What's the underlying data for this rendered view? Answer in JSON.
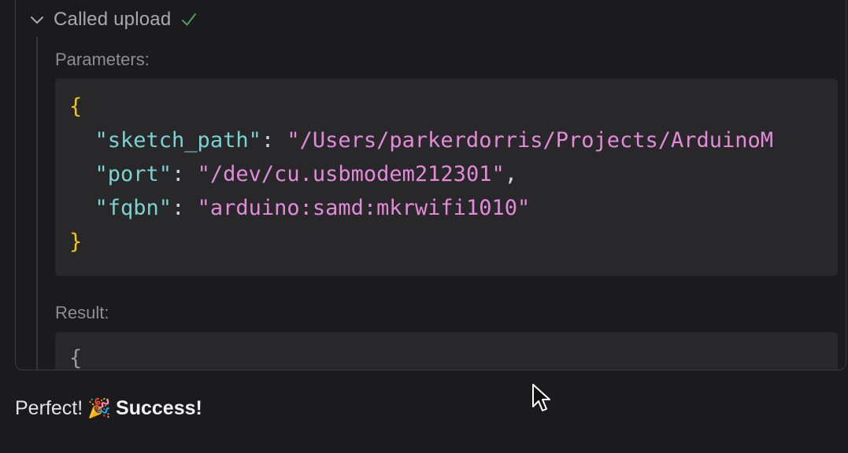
{
  "tool_call": {
    "title": "Called upload",
    "status_icon": "check-icon",
    "parameters_label": "Parameters:",
    "result_label": "Result:",
    "params": {
      "open_brace": "{",
      "close_brace": "}",
      "lines": [
        {
          "key": "\"sketch_path\"",
          "value": "\"/Users/parkerdorris/Projects/ArduinoM",
          "trail": ""
        },
        {
          "key": "\"port\"",
          "value": "\"/dev/cu.usbmodem212301\"",
          "trail": ","
        },
        {
          "key": "\"fqbn\"",
          "value": "\"arduino:samd:mkrwifi1010\"",
          "trail": ""
        }
      ]
    },
    "result_preview": "{"
  },
  "message": {
    "text": "Perfect!",
    "emoji": "🎉",
    "strong": "Success!"
  },
  "colors": {
    "background": "#1b1b1d",
    "code_bg": "#28282b",
    "brace": "#f5c518",
    "key": "#7ad3d1",
    "string": "#e38ad9",
    "check": "#4caf50"
  }
}
